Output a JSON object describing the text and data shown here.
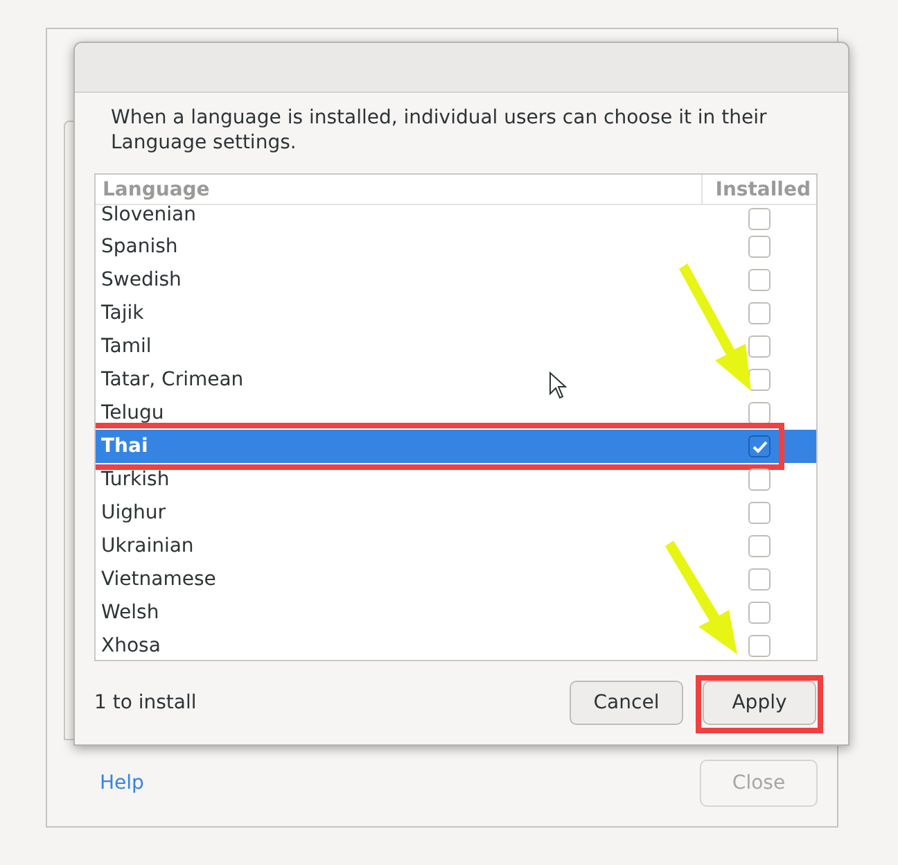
{
  "dialog": {
    "description": "When a language is installed, individual users can choose it in their Language settings.",
    "columns": [
      "Language",
      "Installed"
    ],
    "rows": [
      {
        "language": "Slovenian",
        "installed": false,
        "selected": false
      },
      {
        "language": "Spanish",
        "installed": false,
        "selected": false
      },
      {
        "language": "Swedish",
        "installed": false,
        "selected": false
      },
      {
        "language": "Tajik",
        "installed": false,
        "selected": false
      },
      {
        "language": "Tamil",
        "installed": false,
        "selected": false
      },
      {
        "language": "Tatar, Crimean",
        "installed": false,
        "selected": false
      },
      {
        "language": "Telugu",
        "installed": false,
        "selected": false
      },
      {
        "language": "Thai",
        "installed": true,
        "selected": true
      },
      {
        "language": "Turkish",
        "installed": false,
        "selected": false
      },
      {
        "language": "Uighur",
        "installed": false,
        "selected": false
      },
      {
        "language": "Ukrainian",
        "installed": false,
        "selected": false
      },
      {
        "language": "Vietnamese",
        "installed": false,
        "selected": false
      },
      {
        "language": "Welsh",
        "installed": false,
        "selected": false
      },
      {
        "language": "Xhosa",
        "installed": false,
        "selected": false
      }
    ],
    "status": "1 to install",
    "buttons": [
      {
        "label": "Cancel",
        "highlighted": false
      },
      {
        "label": "Apply",
        "highlighted": true
      }
    ]
  },
  "window": {
    "help_link": "Help",
    "close_button": {
      "label": "Close",
      "disabled": true
    }
  }
}
